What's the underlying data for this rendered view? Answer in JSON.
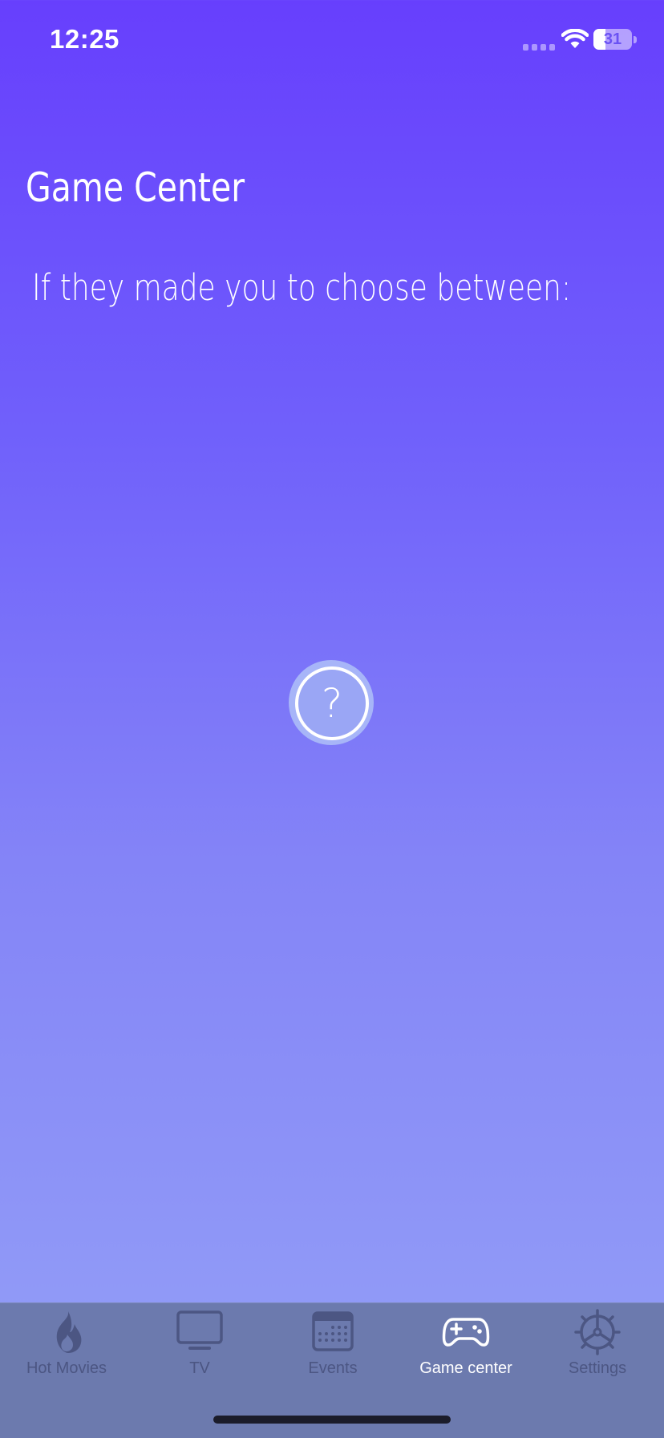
{
  "status_bar": {
    "time": "12:25",
    "battery_level": "31",
    "battery_fraction": 0.31
  },
  "header": {
    "title": "Game Center"
  },
  "main": {
    "question": "If they made you to choose between:",
    "mystery_button_glyph": "?",
    "mystery_button_icon": "question-circle-icon"
  },
  "tab_bar": {
    "active_color": "#ffffff",
    "inactive_color": "#4c5683",
    "items": [
      {
        "label": "Hot Movies",
        "icon": "flame-icon",
        "active": false
      },
      {
        "label": "TV",
        "icon": "tv-icon",
        "active": false
      },
      {
        "label": "Events",
        "icon": "calendar-icon",
        "active": false
      },
      {
        "label": "Game center",
        "icon": "gamepad-icon",
        "active": true
      },
      {
        "label": "Settings",
        "icon": "gear-icon",
        "active": false
      }
    ]
  },
  "colors": {
    "background_top": "#673ffd",
    "background_bottom": "#949ff8",
    "tab_bar_background": "#6c7aae"
  }
}
